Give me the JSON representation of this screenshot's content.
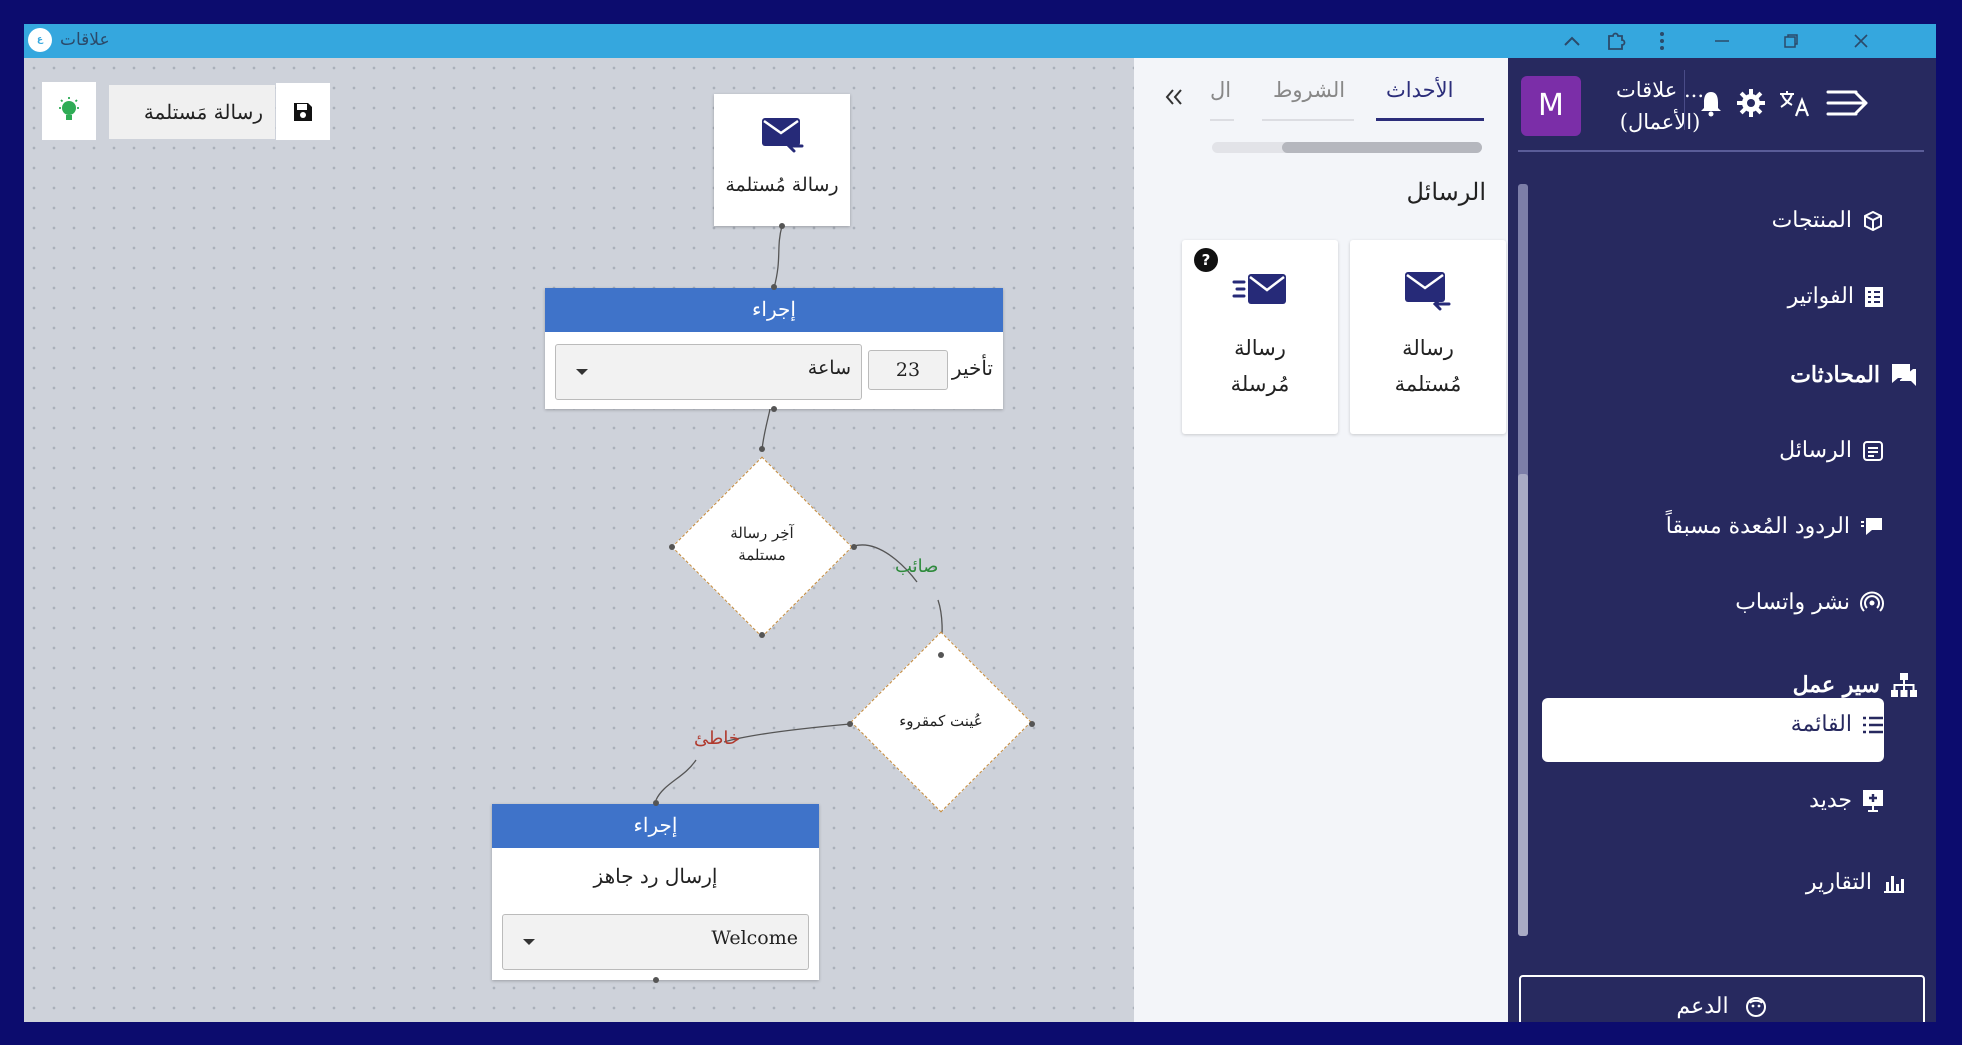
{
  "titlebar": {
    "app_title": "علاقات",
    "logo_text": "ع"
  },
  "canvas": {
    "workflow_name": "رسالة مَستلمة",
    "trigger_node": {
      "label": "رسالة مُستلمة",
      "icon": "mail-receive-icon"
    },
    "action_node_1": {
      "header": "إجراء",
      "delay_label": "تأخير",
      "delay_value": "23",
      "delay_unit": "ساعة"
    },
    "condition_1": {
      "line1": "آخِر رسالة",
      "line2": "مستلمة"
    },
    "edge_true_label": "صائب",
    "condition_2": {
      "label": "عُينت كمقروء"
    },
    "edge_false_label": "خاطئ",
    "action_node_2": {
      "header": "إجراء",
      "action_label": "إرسال رد جاهز",
      "selected_reply": "Welcome"
    },
    "colors": {
      "true_edge": "#2e8b3c",
      "false_edge": "#b03a2e",
      "action_header": "#3f73c9"
    }
  },
  "panel": {
    "tabs": [
      {
        "label": "الأحداث",
        "active": true
      },
      {
        "label": "الشروط",
        "active": false
      },
      {
        "label": "ال",
        "active": false
      }
    ],
    "section_title": "الرسائل",
    "cards": [
      {
        "line1": "رسالة",
        "line2": "مُستلمة",
        "icon": "mail-receive-icon"
      },
      {
        "line1": "رسالة",
        "line2": "مُرسلة",
        "icon": "mail-send-icon",
        "help": "?"
      }
    ]
  },
  "sidebar": {
    "avatar_letter": "M",
    "org_name": "علاقات ...",
    "org_sub": "(الأعمال)",
    "nav": [
      {
        "label": "المنتجات",
        "icon": "cube-icon"
      },
      {
        "label": "الفواتير",
        "icon": "invoice-icon"
      },
      {
        "label": "المحادثات",
        "icon": "chat-icon"
      },
      {
        "label": "الرسائل",
        "icon": "message-icon"
      },
      {
        "label": "الردود المُعدة مسبقاً",
        "icon": "canned-reply-icon"
      },
      {
        "label": "نشر واتساب",
        "icon": "broadcast-icon"
      },
      {
        "label": "سير عمل",
        "icon": "workflow-icon"
      },
      {
        "label": "القائمة",
        "icon": "list-icon",
        "active": true
      },
      {
        "label": "جديد",
        "icon": "add-icon"
      },
      {
        "label": "التقارير",
        "icon": "chart-icon"
      }
    ],
    "support_label": "الدعم"
  }
}
